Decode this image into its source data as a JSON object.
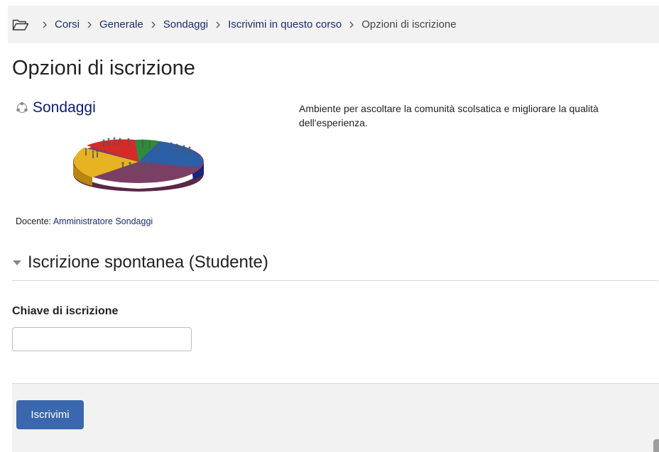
{
  "breadcrumb": {
    "items": [
      {
        "label": "Corsi",
        "link": true
      },
      {
        "label": "Generale",
        "link": true
      },
      {
        "label": "Sondaggi",
        "link": true
      },
      {
        "label": "Iscrivimi in questo corso",
        "link": true
      },
      {
        "label": "Opzioni di iscrizione",
        "link": false
      }
    ],
    "icon": "folder-open-icon"
  },
  "page": {
    "title": "Opzioni di iscrizione"
  },
  "course": {
    "name": "Sondaggi",
    "icon": "course-icon",
    "summary": "Ambiente per ascoltare la comunità scolsatica e migliorare la qualità dell'esperienza.",
    "teacher_label": "Docente:",
    "teacher_name": "Amministratore Sondaggi"
  },
  "enrol": {
    "section_title": "Iscrizione spontanea (Studente)",
    "key_label": "Chiave di iscrizione",
    "key_value": "",
    "key_placeholder": "",
    "button_label": "Iscrivimi"
  },
  "colors": {
    "link": "#1a2d6b",
    "button": "#3a67ad",
    "bar_bg": "#f2f2f2"
  }
}
